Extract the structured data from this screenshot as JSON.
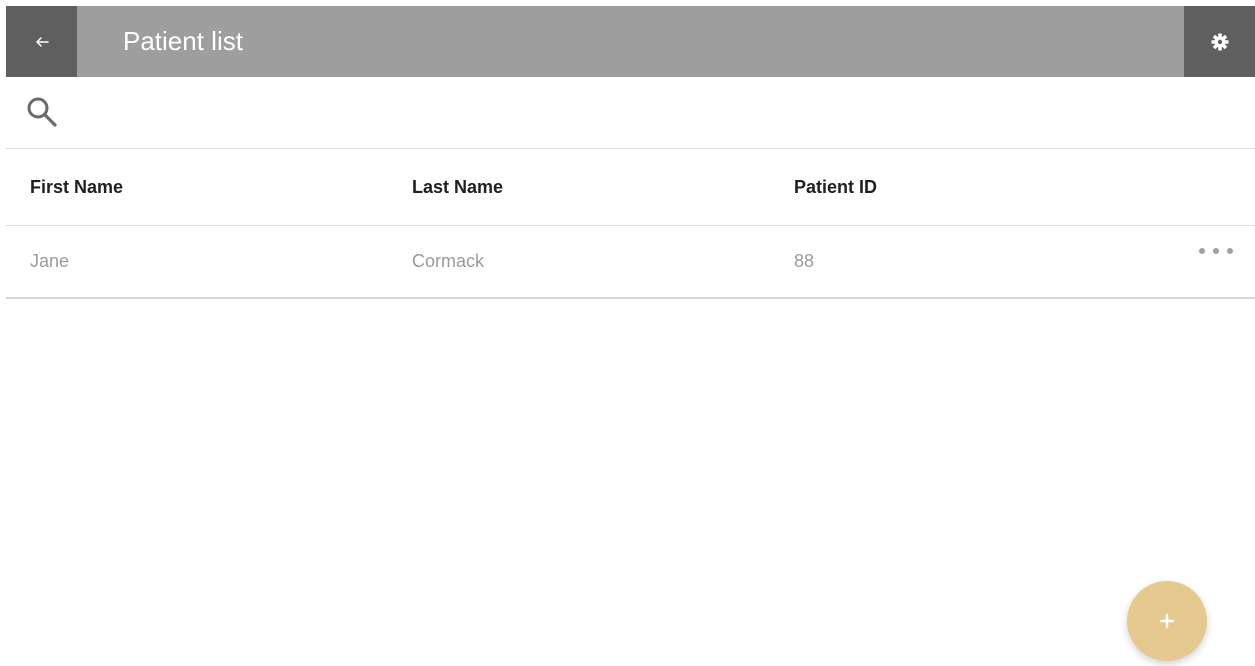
{
  "header": {
    "title": "Patient list",
    "back_icon": "arrow-left-icon",
    "settings_icon": "gear-icon"
  },
  "search": {
    "icon": "search-icon"
  },
  "table": {
    "columns": [
      "First Name",
      "Last Name",
      "Patient ID"
    ],
    "rows": [
      {
        "first_name": "Jane",
        "last_name": "Cormack",
        "patient_id": "88"
      }
    ],
    "row_menu_icon": "more-horizontal-icon"
  },
  "fab": {
    "icon": "plus-icon"
  },
  "colors": {
    "topbar": "#9e9e9e",
    "topbar_buttons": "#5f5f5f",
    "fab": "#e6c98e",
    "header_text": "#202020",
    "row_text": "#9a9a9a"
  }
}
